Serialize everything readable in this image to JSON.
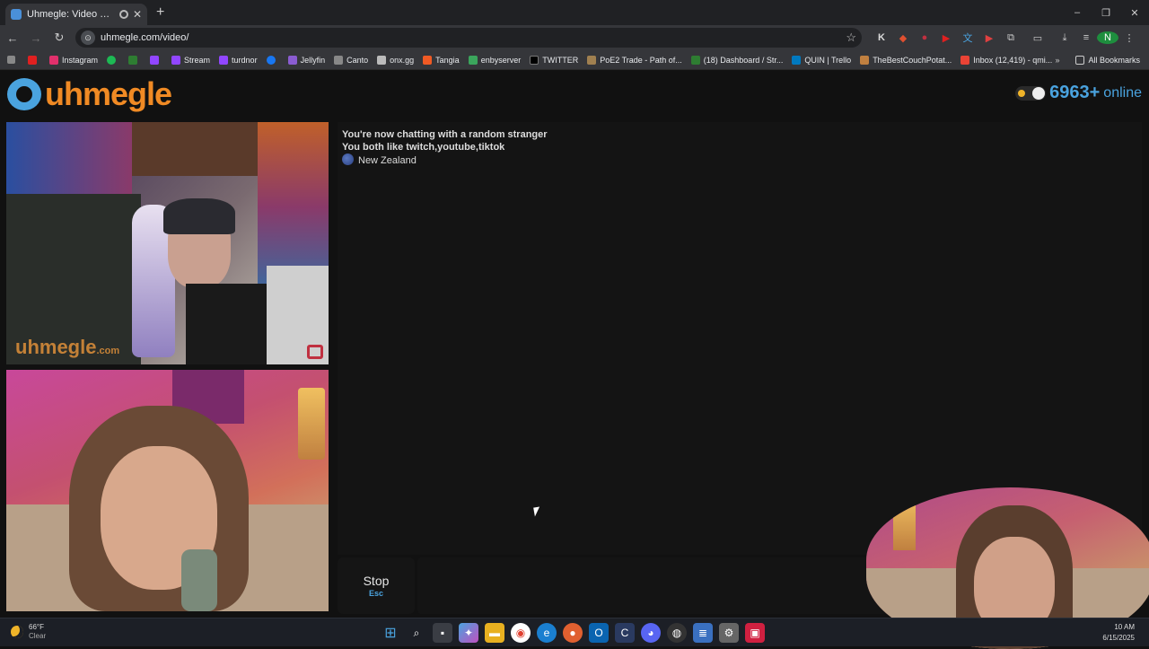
{
  "browser": {
    "tab_title": "Uhmegle: Video Chat | Om...",
    "new_tab_icon": "plus-icon",
    "url": "uhmegle.com/video/",
    "window_controls": [
      "–",
      "❐",
      "✕"
    ]
  },
  "bookmarks": {
    "items": [
      {
        "label": "Instagram",
        "color": "#e1306c"
      },
      {
        "label": "",
        "color": "#1db954"
      },
      {
        "label": "",
        "color": "#2e7d32"
      },
      {
        "label": "",
        "color": "#9146ff"
      },
      {
        "label": "Stream",
        "color": "#9146ff"
      },
      {
        "label": "turdnor",
        "color": "#9146ff"
      },
      {
        "label": "",
        "color": "#1877f2"
      },
      {
        "label": "Jellyfin",
        "color": "#8a5cd1"
      },
      {
        "label": "Canto",
        "color": "#888888"
      },
      {
        "label": "onx.gg",
        "color": "#bbbbbb"
      },
      {
        "label": "Tangia",
        "color": "#f05a24"
      },
      {
        "label": "enbyserver",
        "color": "#3ba55c"
      },
      {
        "label": "TWITTER",
        "color": "#000000"
      },
      {
        "label": "PoE2 Trade - Path of...",
        "color": "#a08050"
      },
      {
        "label": "(18) Dashboard / Str...",
        "color": "#2e7d32"
      },
      {
        "label": "QUIN | Trello",
        "color": "#0079bf"
      },
      {
        "label": "TheBestCouchPotat...",
        "color": "#c08040"
      },
      {
        "label": "Inbox (12,419) - qmi...",
        "color": "#ea4335"
      }
    ],
    "all_bookmarks": "All Bookmarks"
  },
  "header": {
    "logo_text": "uhmegle",
    "online_count": "6963",
    "online_plus": "+",
    "online_label": "online"
  },
  "chat": {
    "message_1": "You're now chatting with a random stranger",
    "message_2": "You both like twitch,youtube,tiktok",
    "country": "New Zealand"
  },
  "controls": {
    "stop_label": "Stop",
    "stop_key": "Esc"
  },
  "video": {
    "watermark": "uhmegle",
    "watermark_suffix": ".com"
  },
  "taskbar": {
    "temperature": "66°F",
    "condition": "Clear",
    "time": "10 AM",
    "date": "6/15/2025"
  },
  "colors": {
    "accent_blue": "#4aa3df",
    "logo_orange": "#f08a24",
    "background": "#111111"
  }
}
